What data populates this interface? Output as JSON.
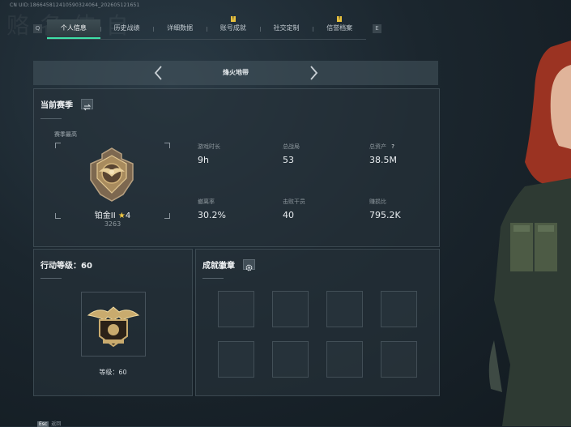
{
  "uid_line": "CN UID:18664581241059032406​4_202605121651",
  "background_text": "赂 名 佶 自",
  "tabs": [
    {
      "label": "个人信息",
      "active": true,
      "badge": ""
    },
    {
      "label": "历史战绩",
      "active": false,
      "badge": ""
    },
    {
      "label": "详细数据",
      "active": false,
      "badge": ""
    },
    {
      "label": "账号成就",
      "active": false,
      "badge": "!"
    },
    {
      "label": "社交定制",
      "active": false,
      "badge": ""
    },
    {
      "label": "信誉档案",
      "active": false,
      "badge": "!"
    }
  ],
  "tab_nav": {
    "left": "Q",
    "right": "E"
  },
  "mode": {
    "title": "烽火地带"
  },
  "season": {
    "title": "当前赛季",
    "peak_label": "赛季最高",
    "rank_name": "铂金II",
    "rank_star_count": "4",
    "rank_score": "3263",
    "stats": [
      {
        "label": "游戏时长",
        "value": "9h"
      },
      {
        "label": "总战局",
        "value": "53"
      },
      {
        "label": "总资产",
        "value": "38.5M",
        "help": "?"
      },
      {
        "label": "撤离率",
        "value": "30.2%"
      },
      {
        "label": "击败干员",
        "value": "40"
      },
      {
        "label": "赚损比",
        "value": "795.2K"
      }
    ]
  },
  "level": {
    "title_prefix": "行动等级：",
    "title_value": "60",
    "label": "等级：60"
  },
  "badges": {
    "title": "成就徽章",
    "slots": 8
  },
  "bottom_hint": {
    "key": "Esc",
    "label": "返回"
  },
  "colors": {
    "accent": "#3fe0a8",
    "badge_yellow": "#e7c13f",
    "star": "#f0c843"
  }
}
